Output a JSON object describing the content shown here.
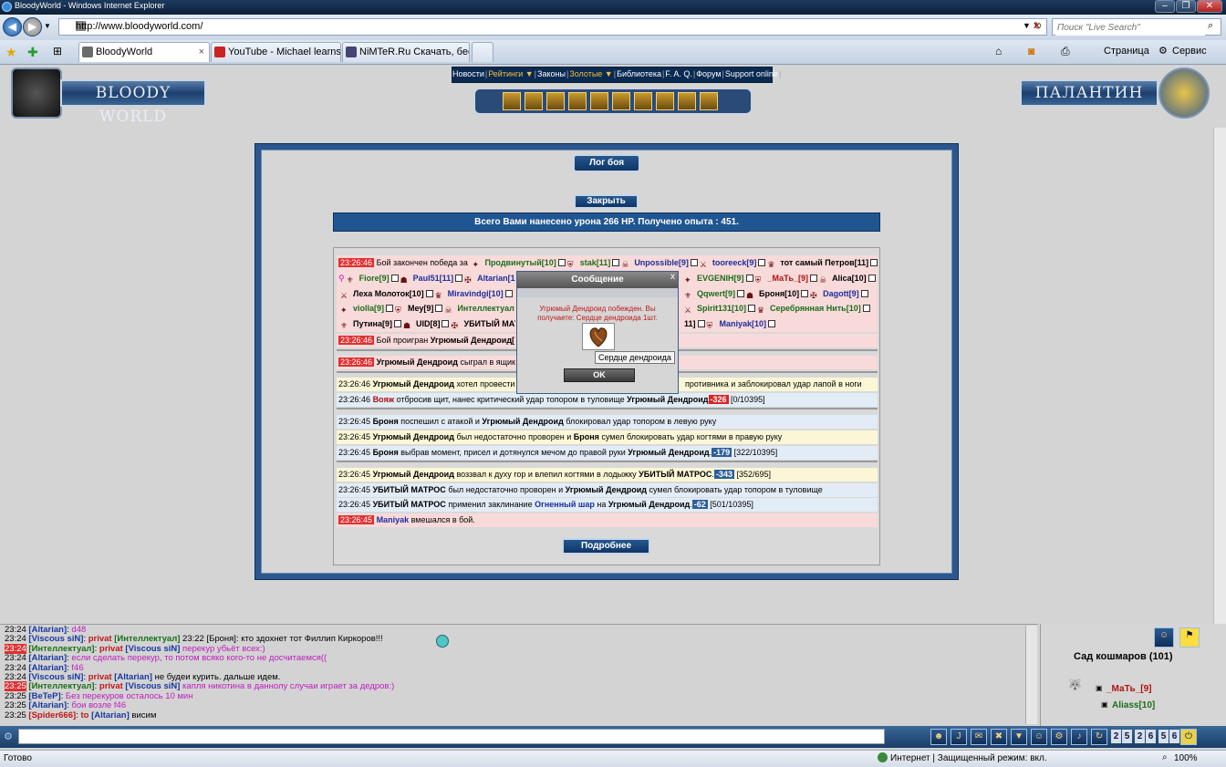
{
  "window": {
    "title": "BloodyWorld - Windows Internet Explorer"
  },
  "browser": {
    "url": "http://www.bloodyworld.com/",
    "search_placeholder": "Поиск \"Live Search\"",
    "tabs": [
      {
        "label": "BloodyWorld",
        "active": true
      },
      {
        "label": "YouTube - Michael learns ...",
        "active": false
      },
      {
        "label": "NiMTeR.Ru Скачать, бесп...",
        "active": false
      }
    ],
    "toolbar": {
      "page": "Страница",
      "service": "Сервис"
    }
  },
  "site": {
    "logo_left": "BLOODY WORLD",
    "logo_right": "ПАЛАНТИН",
    "menu": [
      {
        "label": "Новости",
        "gold": false
      },
      {
        "label": "Рейтинги ▼",
        "gold": true
      },
      {
        "label": "Законы",
        "gold": false
      },
      {
        "label": "Золотые ▼",
        "gold": true
      },
      {
        "label": "Библиотека",
        "gold": false
      },
      {
        "label": "F. A. Q.",
        "gold": false
      },
      {
        "label": "Форум",
        "gold": false
      },
      {
        "label": "Support online",
        "gold": false
      }
    ]
  },
  "battle": {
    "title": "Лог боя",
    "close_label": "Закрыть",
    "summary": "Всего Вами нанесено урона 266 HP. Получено опыта : 451.",
    "more_label": "Подробнее",
    "winner_time": "23:26:46",
    "winner_line1_prefix": "Бой закончен победа за",
    "winner_names": {
      "l1": [
        [
          "Продвинутый[10]",
          "g"
        ],
        [
          "stak[11]",
          "g"
        ],
        [
          "Unpossible[9]",
          "bl"
        ],
        [
          "tooreeck[9]",
          "bl"
        ],
        [
          "тот самый Петров[11]",
          "b"
        ]
      ],
      "l2a": [
        [
          "Fiore[9]",
          "g"
        ],
        [
          "Paul51[11]",
          "bl"
        ],
        [
          "Altarian[1",
          "bl"
        ]
      ],
      "l2b": [
        [
          "EVGENIH[9]",
          "g"
        ],
        [
          "_МаТь_[9]",
          "rd"
        ],
        [
          "Alica[10]",
          "b"
        ]
      ],
      "l3a": [
        [
          "Леха Молоток[10]",
          "b"
        ],
        [
          "Miravindgi[10]",
          "bl"
        ]
      ],
      "l3b": [
        [
          "Qqwert[9]",
          "g"
        ],
        [
          "Броня[10]",
          "b"
        ],
        [
          "Dagott[9]",
          "bl"
        ]
      ],
      "l4a": [
        [
          "violla[9]",
          "g"
        ],
        [
          "Меу[9]",
          "b"
        ],
        [
          "Интеллектуал",
          "g"
        ]
      ],
      "l4b": [
        [
          "Spirit131[10]",
          "g"
        ],
        [
          "Серебрянная Нить[10]",
          "g"
        ]
      ],
      "l5a": [
        [
          "Путина[9]",
          "b"
        ],
        [
          "UID[8]",
          "b"
        ],
        [
          "УБИТЫЙ МАТРОС",
          "b"
        ]
      ],
      "l5b": [
        [
          "11]",
          "b"
        ],
        [
          "Maniyak[10]",
          "bl"
        ]
      ]
    },
    "lines": [
      {
        "time": "23:26:46",
        "red": true,
        "bg": "pink",
        "parts": [
          [
            "Бой проигран ",
            ""
          ],
          [
            "Угрюмый Дендроид[",
            "b"
          ]
        ]
      },
      {
        "time": "23:26:46",
        "red": true,
        "bg": "pink",
        "parts": [
          [
            "Угрюмый Дендроид",
            "b"
          ],
          [
            " сыграл в ящик",
            ""
          ]
        ]
      },
      {
        "time": "23:26:46",
        "red": false,
        "bg": "yellow",
        "parts": [
          [
            "Угрюмый Дендроид",
            "b"
          ],
          [
            " хотел провести ",
            ""
          ],
          [
            "противника и заблокировал удар лапой в ноги",
            "",
            "right"
          ]
        ]
      },
      {
        "time": "23:26:46",
        "red": false,
        "bg": "blue",
        "parts": [
          [
            "Вояж",
            "rd"
          ],
          [
            " отбросив щит, нанес критический удар топором в туловище ",
            ""
          ],
          [
            "Угрюмый Дендроид",
            "b"
          ],
          [
            "-326",
            "dmg"
          ],
          [
            " [0/10395]",
            ""
          ]
        ]
      },
      {
        "time": "23:26:45",
        "red": false,
        "bg": "blue",
        "parts": [
          [
            "Броня",
            "b"
          ],
          [
            " поспешил с атакой и ",
            ""
          ],
          [
            "Угрюмый Дендроид",
            "b"
          ],
          [
            " блокировал удар топором в левую руку",
            ""
          ]
        ]
      },
      {
        "time": "23:26:45",
        "red": false,
        "bg": "yellow",
        "parts": [
          [
            "Угрюмый Дендроид",
            "b"
          ],
          [
            " был недостаточно проворен и ",
            ""
          ],
          [
            "Броня",
            "b"
          ],
          [
            " сумел блокировать удар когтями в правую руку",
            ""
          ]
        ]
      },
      {
        "time": "23:26:45",
        "red": false,
        "bg": "blue",
        "parts": [
          [
            "Броня",
            "b"
          ],
          [
            " выбрав момент, присел и дотянулся мечом до правой руки ",
            ""
          ],
          [
            "Угрюмый Дендроид",
            "b"
          ],
          [
            ".",
            ""
          ],
          [
            "-179",
            "dmgb"
          ],
          [
            " [322/10395]",
            ""
          ]
        ]
      },
      {
        "time": "23:26:45",
        "red": false,
        "bg": "yellow",
        "parts": [
          [
            "Угрюмый Дендроид",
            "b"
          ],
          [
            " воззвал к духу гор и влепил когтями в лодыжку ",
            ""
          ],
          [
            "УБИТЫЙ МАТРОС",
            "b"
          ],
          [
            ".",
            ""
          ],
          [
            "-343",
            "dmgb"
          ],
          [
            " [352/695]",
            ""
          ]
        ]
      },
      {
        "time": "23:26:45",
        "red": false,
        "bg": "blue",
        "parts": [
          [
            "УБИТЫЙ МАТРОС",
            "b"
          ],
          [
            " был недостаточно проворен и ",
            ""
          ],
          [
            "Угрюмый Дендроид",
            "b"
          ],
          [
            " сумел блокировать удар топором в туловище",
            ""
          ]
        ]
      },
      {
        "time": "23:26:45",
        "red": false,
        "bg": "blue",
        "parts": [
          [
            "УБИТЫЙ МАТРОС",
            "b"
          ],
          [
            " применил заклинание ",
            ""
          ],
          [
            "Огненный шар",
            "sp"
          ],
          [
            " на ",
            ""
          ],
          [
            "Угрюмый Дендроид",
            "b"
          ],
          [
            ".",
            ""
          ],
          [
            "-62",
            "dmgb"
          ],
          [
            " [501/10395]",
            ""
          ]
        ]
      },
      {
        "time": "23:26:45",
        "red": true,
        "bg": "pink",
        "parts": [
          [
            "Maniyak",
            "bl"
          ],
          [
            " вмешался в бой.",
            ""
          ]
        ]
      }
    ]
  },
  "dialog": {
    "title": "Сообщение",
    "close": "x",
    "message": "Угрюмый Дендроид побежден. Вы получаете: Сердце дендроида 1шт.",
    "tooltip": "Сердце дендроида",
    "ok": "OK"
  },
  "chat": [
    {
      "time": "23:24",
      "red": false,
      "parts": [
        [
          "[Altarian]",
          "cblue"
        ],
        [
          ": ",
          "cblk"
        ],
        [
          "d48",
          "cmag"
        ]
      ]
    },
    {
      "time": "23:24",
      "red": false,
      "parts": [
        [
          "[Viscous siN]",
          "cblue"
        ],
        [
          ": ",
          "cblk"
        ],
        [
          "privat ",
          "cred"
        ],
        [
          "[Интеллектуал]",
          "cgreen"
        ],
        [
          " 23:22 [Броня]: кто здохнет тот Филлип Киркоров!!!",
          "cblk"
        ]
      ]
    },
    {
      "time": "23:24",
      "red": true,
      "parts": [
        [
          "[Интеллектуал]",
          "cgreen"
        ],
        [
          ": ",
          "cblk"
        ],
        [
          "privat ",
          "cred"
        ],
        [
          "[Viscous siN]",
          "cblue"
        ],
        [
          " перекур убьёт всех:)",
          "cmag"
        ]
      ]
    },
    {
      "time": "23:24",
      "red": false,
      "parts": [
        [
          "[Altarian]",
          "cblue"
        ],
        [
          ": ",
          "cblk"
        ],
        [
          "если сделать перекур, то потом всяко кого-то не досчитаемся((",
          "cmag"
        ]
      ]
    },
    {
      "time": "23:24",
      "red": false,
      "parts": [
        [
          "[Altarian]",
          "cblue"
        ],
        [
          ": ",
          "cblk"
        ],
        [
          "f46",
          "cmag"
        ]
      ]
    },
    {
      "time": "23:24",
      "red": false,
      "parts": [
        [
          "[Viscous siN]",
          "cblue"
        ],
        [
          ": ",
          "cblk"
        ],
        [
          "privat ",
          "cred"
        ],
        [
          "[Altarian]",
          "cblue"
        ],
        [
          " не будеи курить. дальше идем.",
          "cblk"
        ]
      ]
    },
    {
      "time": "23:25",
      "red": true,
      "parts": [
        [
          "[Интеллектуал]",
          "cgreen"
        ],
        [
          ": ",
          "cblk"
        ],
        [
          "privat ",
          "cred"
        ],
        [
          "[Viscous siN]",
          "cblue"
        ],
        [
          " капля никотина в даннолу случаи играет за дедров:)",
          "cmag"
        ]
      ]
    },
    {
      "time": "23:25",
      "red": false,
      "parts": [
        [
          "[BeTeP]",
          "cblue"
        ],
        [
          ": ",
          "cblk"
        ],
        [
          "Без перекуров осталось 10 мин",
          "cmag"
        ]
      ]
    },
    {
      "time": "23:25",
      "red": false,
      "parts": [
        [
          "[Altarian]",
          "cblue"
        ],
        [
          ": ",
          "cblk"
        ],
        [
          "бои возле f46",
          "cmag"
        ]
      ]
    },
    {
      "time": "23:25",
      "red": false,
      "parts": [
        [
          "[Spider666]",
          "cred"
        ],
        [
          ": ",
          "cblk"
        ],
        [
          "to ",
          "cred"
        ],
        [
          "[Altarian]",
          "cblue"
        ],
        [
          " висим",
          "cblk"
        ]
      ]
    }
  ],
  "location": {
    "name": "Сад кошмаров (101)",
    "players": [
      "_МаТь_[9]",
      "Aliass[10]"
    ]
  },
  "clock": [
    "2",
    "5",
    "2",
    "6",
    "5",
    "6"
  ],
  "status": {
    "left": "Готово",
    "zone": "Интернет | Защищенный режим: вкл.",
    "zoom": "100%"
  }
}
